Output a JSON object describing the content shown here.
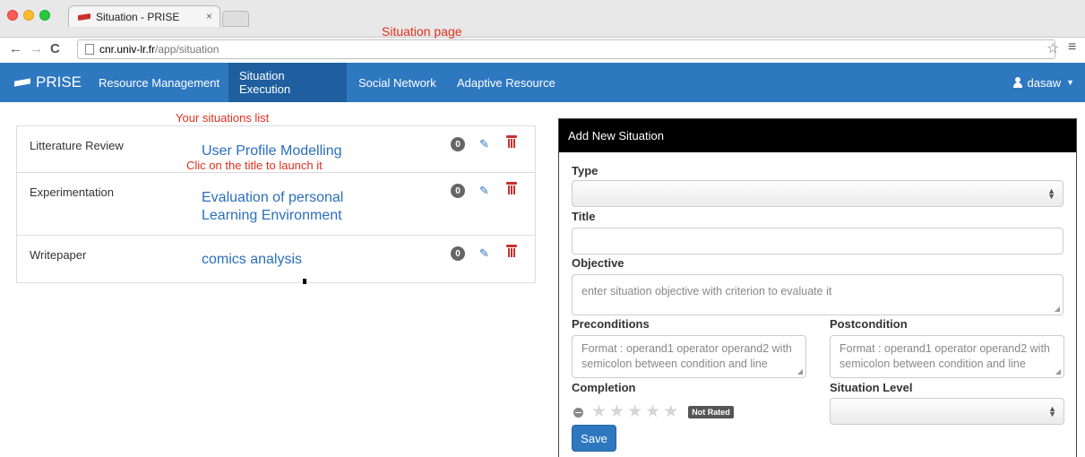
{
  "browser": {
    "tab_title": "Situation - PRISE",
    "tab_close": "×",
    "url_host": "cnr.univ-lr.fr",
    "url_path": "/app/situation"
  },
  "annotations": {
    "page": "Situation page",
    "list": "Your situations list",
    "launch": "Clic on the title to launch it"
  },
  "navbar": {
    "brand": "PRISE",
    "items": [
      "Resource Management",
      "Situation Execution",
      "Social Network",
      "Adaptive Resource"
    ],
    "active_index": 1,
    "user": "dasaw"
  },
  "situations": [
    {
      "name": "Litterature Review",
      "title": "User Profile Modelling",
      "count": "0"
    },
    {
      "name": "Experimentation",
      "title_line1": "Evaluation of personal",
      "title_line2": "Learning Environment",
      "count": "0"
    },
    {
      "name": "Writepaper",
      "title": "comics analysis",
      "count": "0"
    }
  ],
  "form": {
    "header": "Add New Situation",
    "type_label": "Type",
    "title_label": "Title",
    "objective_label": "Objective",
    "objective_placeholder": "enter situation objective with criterion to evaluate it",
    "preconditions_label": "Preconditions",
    "preconditions_placeholder_1": "Format : operand1 operator operand2 with",
    "preconditions_placeholder_2": "semicolon between condition and line",
    "postcondition_label": "Postcondition",
    "postcondition_placeholder_1": "Format : operand1 operator operand2 with",
    "postcondition_placeholder_2": "semicolon between condition and line",
    "completion_label": "Completion",
    "rating_badge": "Not Rated",
    "situation_level_label": "Situation Level",
    "save_label": "Save"
  },
  "colors": {
    "navbar": "#2e78c0",
    "active_nav": "#1f5f9f",
    "annotation": "#e0301e",
    "link": "#2a6ebb",
    "delete": "#c9302c"
  },
  "icons": [
    "graduation-cap-icon",
    "user-icon",
    "edit-icon",
    "trash-icon",
    "star-icon",
    "back-icon",
    "forward-icon",
    "reload-icon",
    "bookmark-star-icon",
    "menu-icon"
  ]
}
